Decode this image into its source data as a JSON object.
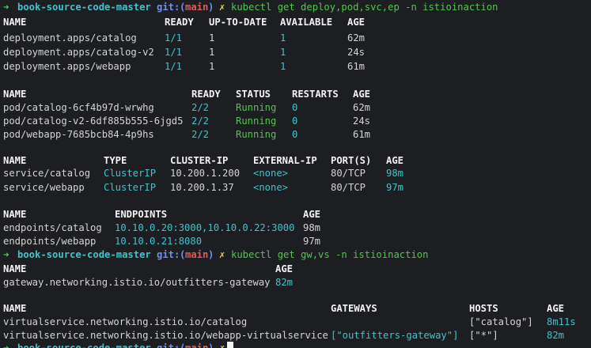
{
  "prompt": {
    "arrow": "➜",
    "dir": "book-source-code-master",
    "git": "git:",
    "paren_open": "(",
    "branch": "main",
    "paren_close": ")",
    "dirty": "✗"
  },
  "commands": [
    "kubectl get deploy,pod,svc,ep -n istioinaction",
    "kubectl get gw,vs -n istioinaction"
  ],
  "deployments": {
    "headers": [
      "NAME",
      "READY",
      "UP-TO-DATE",
      "AVAILABLE",
      "AGE"
    ],
    "rows": [
      [
        "deployment.apps/catalog",
        "1/1",
        "1",
        "1",
        "62m"
      ],
      [
        "deployment.apps/catalog-v2",
        "1/1",
        "1",
        "1",
        "24s"
      ],
      [
        "deployment.apps/webapp",
        "1/1",
        "1",
        "1",
        "61m"
      ]
    ]
  },
  "pods": {
    "headers": [
      "NAME",
      "READY",
      "STATUS",
      "RESTARTS",
      "AGE"
    ],
    "rows": [
      [
        "pod/catalog-6cf4b97d-wrwhg",
        "2/2",
        "Running",
        "0",
        "62m"
      ],
      [
        "pod/catalog-v2-6df885b555-6jgd5",
        "2/2",
        "Running",
        "0",
        "24s"
      ],
      [
        "pod/webapp-7685bcb84-4p9hs",
        "2/2",
        "Running",
        "0",
        "61m"
      ]
    ]
  },
  "services": {
    "headers": [
      "NAME",
      "TYPE",
      "CLUSTER-IP",
      "EXTERNAL-IP",
      "PORT(S)",
      "AGE"
    ],
    "rows": [
      [
        "service/catalog",
        "ClusterIP",
        "10.200.1.200",
        "<none>",
        "80/TCP",
        "98m"
      ],
      [
        "service/webapp",
        "ClusterIP",
        "10.200.1.37",
        "<none>",
        "80/TCP",
        "97m"
      ]
    ]
  },
  "endpoints": {
    "headers": [
      "NAME",
      "ENDPOINTS",
      "AGE"
    ],
    "rows": [
      [
        "endpoints/catalog",
        "10.10.0.20:3000,10.10.0.22:3000",
        "98m"
      ],
      [
        "endpoints/webapp",
        "10.10.0.21:8080",
        "97m"
      ]
    ]
  },
  "gateways": {
    "headers": [
      "NAME",
      "AGE"
    ],
    "rows": [
      [
        "gateway.networking.istio.io/outfitters-gateway",
        "82m"
      ]
    ]
  },
  "virtualservices": {
    "headers": [
      "NAME",
      "GATEWAYS",
      "HOSTS",
      "AGE"
    ],
    "rows": [
      [
        "virtualservice.networking.istio.io/catalog",
        "",
        "[\"catalog\"]",
        "8m11s"
      ],
      [
        "virtualservice.networking.istio.io/webapp-virtualservice",
        "[\"outfitters-gateway\"]",
        "[\"*\"]",
        "82m"
      ]
    ]
  },
  "colors": {
    "background": "#1d1e22",
    "text": "#d4d4d4",
    "cyan": "#3fc3cc",
    "green": "#4fc74a",
    "blue": "#6f8ff0",
    "red": "#e05a5a",
    "yellow": "#e6d84a"
  }
}
